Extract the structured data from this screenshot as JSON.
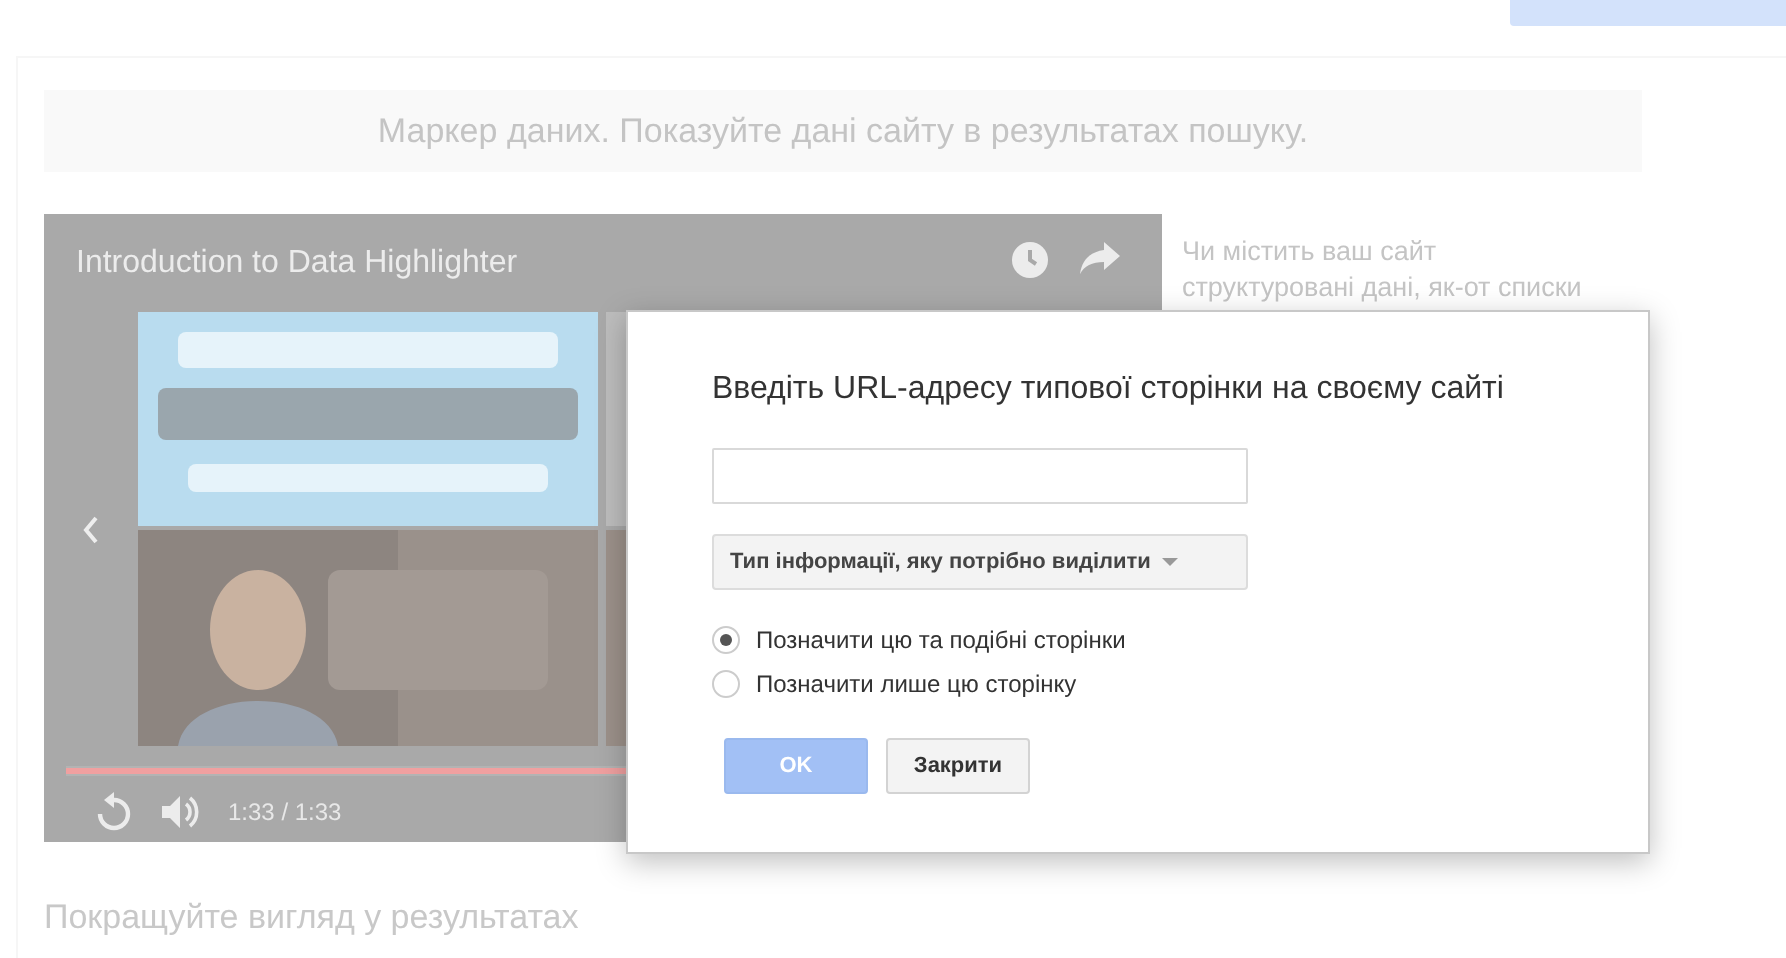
{
  "header": {
    "text": "Маркер даних. Показуйте дані сайту в результатах пошуку."
  },
  "video": {
    "title": "Introduction to Data Highlighter",
    "progress": {
      "level": 1
    },
    "time": "1:33 / 1:33"
  },
  "side_text": "Чи містить ваш сайт структуровані дані, як-от списки",
  "section_heading": "Покращуйте вигляд у результатах",
  "dialog": {
    "title": "Введіть URL-адресу типової сторінки на своєму сайті",
    "dropdown": "Тип інформації, яку потрібно виділити",
    "options": [
      {
        "label": "Позначити цю та подібні сторінки",
        "selected": true
      },
      {
        "label": "Позначити лише цю сторінку",
        "selected": false
      }
    ],
    "buttons": [
      {
        "label": "OK",
        "kind": "primary"
      },
      {
        "label": "Закрити",
        "kind": "secondary"
      }
    ]
  }
}
